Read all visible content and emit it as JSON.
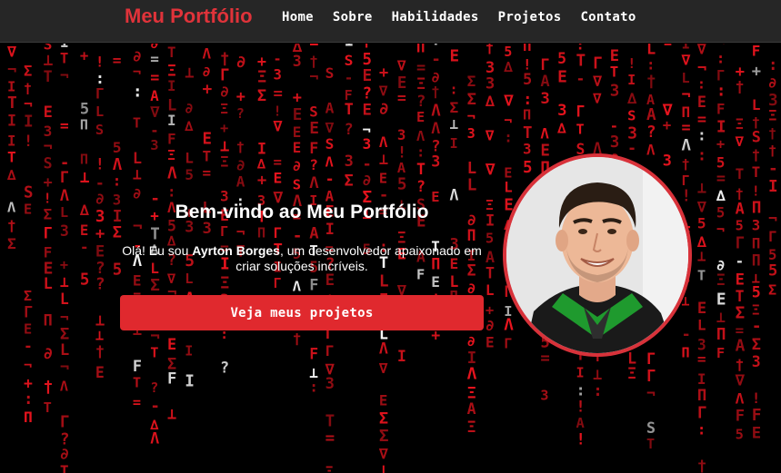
{
  "nav": {
    "brand": "Meu Portfólio",
    "links": [
      "Home",
      "Sobre",
      "Habilidades",
      "Projetos",
      "Contato"
    ]
  },
  "hero": {
    "title": "Bem-vindo ao Meu Portfólio",
    "intro_before": "Olá! Eu sou ",
    "name": "Ayrton Borges",
    "intro_after": ", um desenvolvedor apaixonado em criar soluções incríveis.",
    "cta_label": "Veja meus projetos"
  },
  "colors": {
    "accent": "#e0333a",
    "navbar_bg": "#262626",
    "rain_red": "#e8141e",
    "rain_white": "#ffffff"
  },
  "icons": {
    "avatar": "profile-photo"
  }
}
